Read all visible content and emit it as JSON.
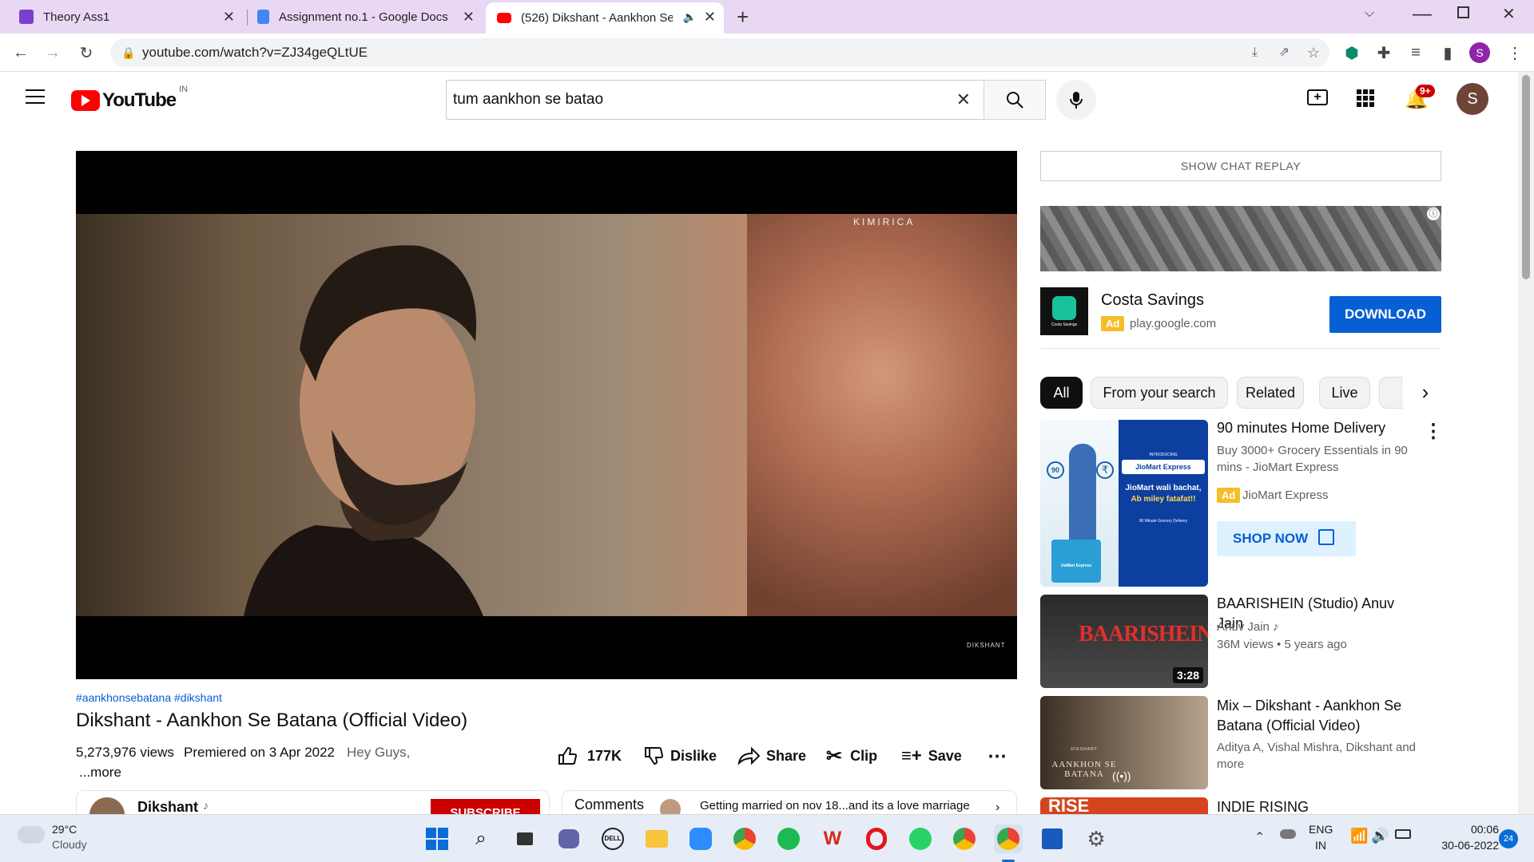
{
  "tabs": [
    {
      "title": "Theory Ass1",
      "favicon_color": "#7b3fd0"
    },
    {
      "title": "Assignment no.1 - Google Docs",
      "favicon_color": "#4285f4"
    },
    {
      "title": "(526) Dikshant - Aankhon Se",
      "favicon_color": "#ff0000"
    }
  ],
  "address": {
    "url": "youtube.com/watch?v=ZJ34geQLtUE"
  },
  "profile_initial": "S",
  "youtube": {
    "logo_text": "YouTube",
    "region": "IN",
    "search_value": "tum aankhon se batao",
    "notification_count": "9+",
    "avatar_initial": "S"
  },
  "video": {
    "watermark_top": "KIMIRICA",
    "watermark_bottom": "DIKSHANT",
    "hashtags": "#aankhonsebatana #dikshant",
    "title": "Dikshant - Aankhon Se Batana (Official Video)",
    "views": "5,273,976 views",
    "premiered": "Premiered on 3 Apr 2022",
    "description": "Hey Guys,",
    "more": "...more",
    "likes": "177K",
    "dislike": "Dislike",
    "share": "Share",
    "clip": "Clip",
    "save": "Save",
    "channel": "Dikshant",
    "subscribe": "SUBSCRIBE",
    "comments_label": "Comments",
    "top_comment": "Getting married on nov 18...and its a love marriage"
  },
  "sidebar": {
    "chat_replay": "SHOW CHAT REPLAY",
    "ad": {
      "name": "Costa Savings",
      "badge": "Ad",
      "domain": "play.google.com",
      "cta": "DOWNLOAD",
      "icon_caption": "Costa Savings"
    },
    "chips": [
      "All",
      "From your search",
      "Related",
      "Live"
    ],
    "promo": {
      "title": "90 minutes Home Delivery",
      "desc": "Buy 3000+ Grocery Essentials in 90 mins - JioMart Express",
      "badge": "Ad",
      "advertiser": "JioMart Express",
      "cta": "SHOP NOW",
      "thumb_small": "INTRODUCING",
      "thumb_brand": "JioMart Express",
      "thumb_line1": "JioMart wali bachat,",
      "thumb_line2": "Ab miley fatafat!!",
      "thumb_line3": "90 Minute Grocery Delivery",
      "thumb_badge": "90",
      "thumb_bag": "JioMart Express"
    },
    "videos": [
      {
        "title": "BAARISHEIN (Studio) Anuv Jain",
        "channel": "Anuv Jain",
        "meta": "36M views • 5 years ago",
        "duration": "3:28",
        "thumb_text": "BAARISHEIN"
      },
      {
        "title": "Mix – Dikshant - Aankhon Se Batana (Official Video)",
        "channel": "Aditya A, Vishal Mishra, Dikshant and more",
        "thumb_text": "AANKHON SE BATANA",
        "thumb_small": "DIKSHANT"
      },
      {
        "title": "INDIE RISING",
        "thumb_text": "RISE"
      }
    ]
  },
  "taskbar": {
    "weather_temp": "29°C",
    "weather_desc": "Cloudy",
    "lang": "ENG",
    "region": "IN",
    "time": "00:06",
    "date": "30-06-2022",
    "notif_count": "24"
  }
}
